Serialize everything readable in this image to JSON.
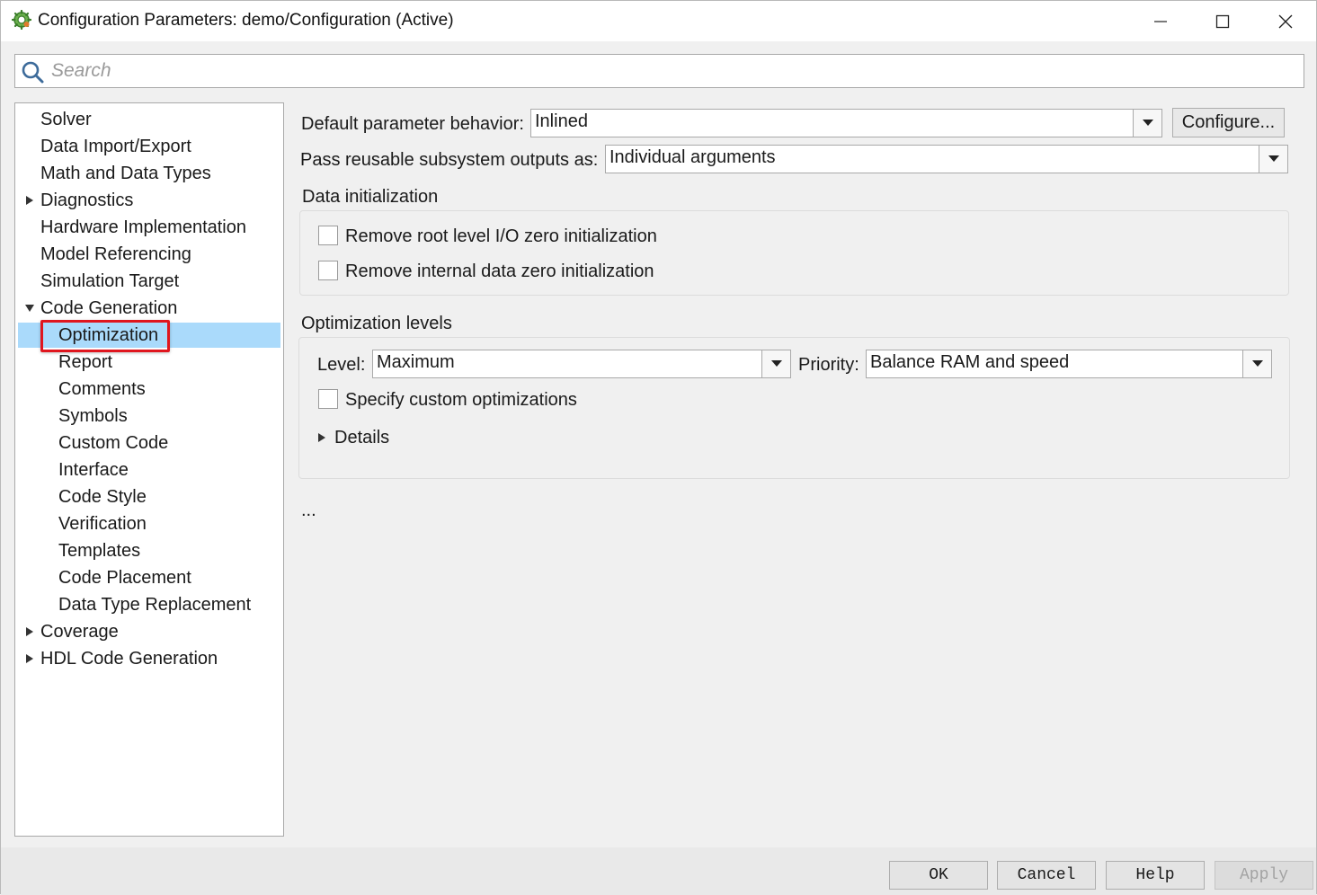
{
  "window": {
    "title": "Configuration Parameters: demo/Configuration (Active)"
  },
  "search": {
    "placeholder": "Search"
  },
  "tree": {
    "items": [
      {
        "label": "Solver"
      },
      {
        "label": "Data Import/Export"
      },
      {
        "label": "Math and Data Types"
      },
      {
        "label": "Diagnostics"
      },
      {
        "label": "Hardware Implementation"
      },
      {
        "label": "Model Referencing"
      },
      {
        "label": "Simulation Target"
      },
      {
        "label": "Code Generation"
      },
      {
        "label": "Optimization"
      },
      {
        "label": "Report"
      },
      {
        "label": "Comments"
      },
      {
        "label": "Symbols"
      },
      {
        "label": "Custom Code"
      },
      {
        "label": "Interface"
      },
      {
        "label": "Code Style"
      },
      {
        "label": "Verification"
      },
      {
        "label": "Templates"
      },
      {
        "label": "Code Placement"
      },
      {
        "label": "Data Type Replacement"
      },
      {
        "label": "Coverage"
      },
      {
        "label": "HDL Code Generation"
      }
    ],
    "selected": "Optimization"
  },
  "main": {
    "default_param": {
      "label": "Default parameter behavior:",
      "value": "Inlined",
      "configure_label": "Configure..."
    },
    "reusable": {
      "label": "Pass reusable subsystem outputs as:",
      "value": "Individual arguments"
    },
    "data_init": {
      "heading": "Data initialization",
      "options": [
        {
          "label": "Remove root level I/O zero initialization",
          "checked": false
        },
        {
          "label": "Remove internal data zero initialization",
          "checked": false
        }
      ]
    },
    "opt_levels": {
      "heading": "Optimization levels",
      "level_label": "Level:",
      "level_value": "Maximum",
      "priority_label": "Priority:",
      "priority_value": "Balance RAM and speed",
      "custom_label": "Specify custom optimizations",
      "custom_checked": false,
      "details_label": "Details"
    },
    "more": "..."
  },
  "footer": {
    "ok": "OK",
    "cancel": "Cancel",
    "help": "Help",
    "apply": "Apply"
  }
}
